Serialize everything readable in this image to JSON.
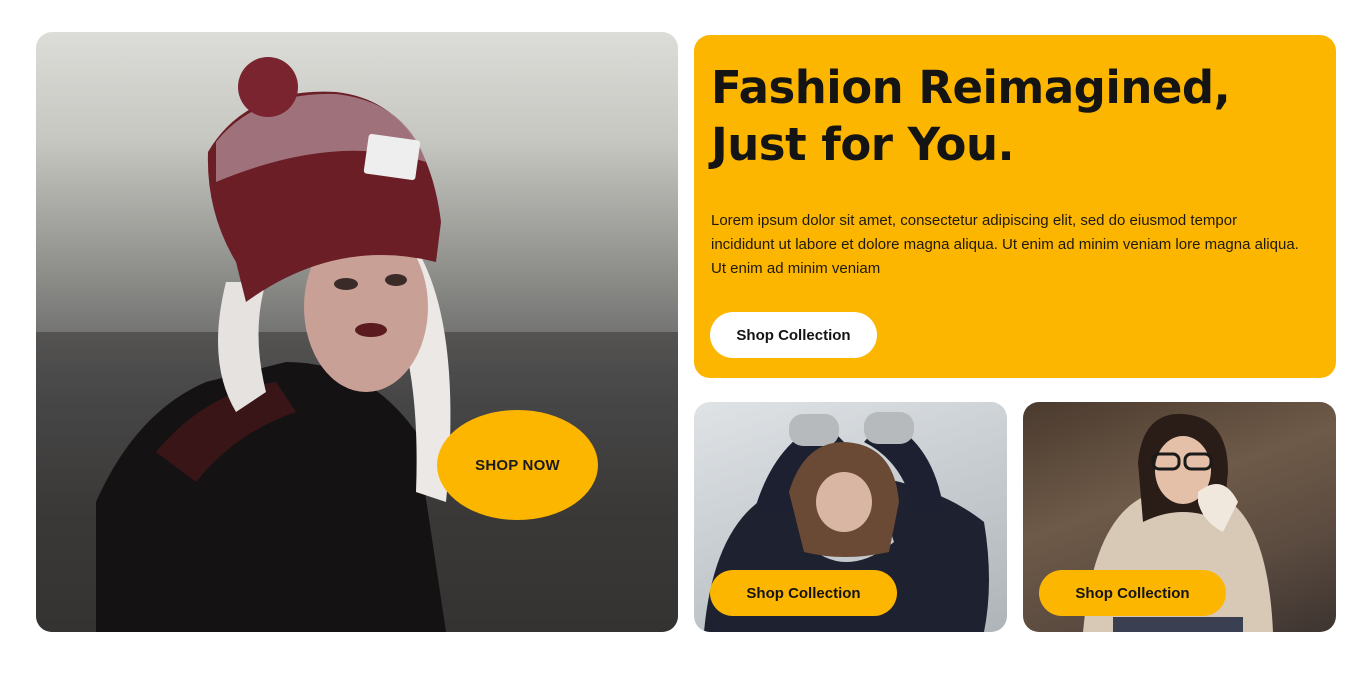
{
  "hero": {
    "image_alt": "woman-in-beanie-photo",
    "cta_label": "SHOP NOW"
  },
  "promo": {
    "title": "Fashion Reimagined, Just for You.",
    "description": "Lorem ipsum dolor sit amet, consectetur adipiscing elit, sed do eiusmod tempor incididunt ut labore et dolore magna aliqua. Ut enim ad minim veniam lore magna aliqua. Ut enim ad minim veniam",
    "cta_label": "Shop Collection"
  },
  "cards": [
    {
      "cta_label": "Shop Collection"
    },
    {
      "cta_label": "Shop Collection"
    }
  ],
  "colors": {
    "accent": "#fdb600",
    "text_dark": "#141414",
    "button_light": "#ffffff"
  }
}
